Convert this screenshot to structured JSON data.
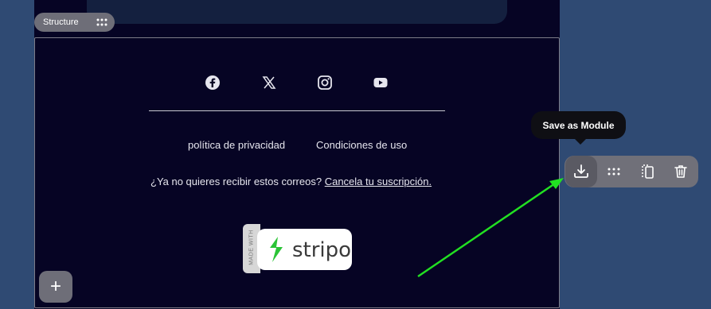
{
  "structure": {
    "label": "Structure"
  },
  "footer": {
    "social_icons": [
      "facebook-icon",
      "x-icon",
      "instagram-icon",
      "youtube-icon"
    ],
    "links": [
      "política de privacidad",
      "Condiciones de uso"
    ],
    "unsubscribe_text": "¿Ya no quieres recibir estos correos?",
    "unsubscribe_link": "Cancela tu suscripción."
  },
  "badge": {
    "made_with": "MADE WITH",
    "brand": "stripo"
  },
  "add_button": {
    "label": "+"
  },
  "tooltip": {
    "text": "Save as Module"
  },
  "toolbar": {
    "items": [
      "save-as-module-icon",
      "move-icon",
      "duplicate-icon",
      "delete-icon"
    ]
  },
  "colors": {
    "page_bg": "#2f4a73",
    "email_bg": "#060424",
    "toolbar_bg": "#707079",
    "arrow": "#22e022",
    "brand_green": "#2bc437"
  }
}
